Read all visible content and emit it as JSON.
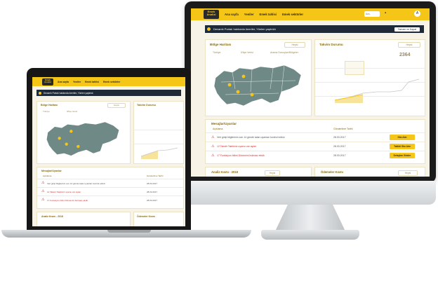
{
  "brand": {
    "logo_top": "Emek",
    "logo_bottom": "Analizi",
    "accent": "#f5c518",
    "dark": "#1f2a38"
  },
  "nav": {
    "items": [
      "Ana sayfa",
      "Yeniler",
      "Emek tahlisi",
      "Emek sektörler"
    ]
  },
  "alert": {
    "text": "Devamlı Portalı hakkında öneriler, Yönlen yaptrıldı",
    "button": "Tamam ve Kapat"
  },
  "sections": {
    "map_title": "Bölge Haritası",
    "filter_label": "Hepsi",
    "status_title": "Takvim Durumu",
    "status_value": "2364",
    "chart_legend": [
      "2019",
      "2020"
    ],
    "warnings_title": "Mesajlar/Uyarılar",
    "col_desc": "Açıklama",
    "col_date": "Gönderilme Tarihi",
    "bottom_left_title": "Analiz Kısmı - 2018",
    "bottom_right_title": "Ödemeler Kısmı"
  },
  "warnings": [
    {
      "text": "Veri girişi bilgilerinin son 14 günde talan uyarıları kontrol ediniz",
      "date": "28.03.2017",
      "action": "Göz Atın"
    },
    {
      "text": "12 Takstir Talebiniz uyarısı var ayları",
      "date": "28.03.2017",
      "action": "Taklidi Göz Atın"
    },
    {
      "text": "17 Fonksiyon bilimi Dönemini bulması eksik",
      "date": "28.03.2017",
      "action": "Detayları Göster"
    }
  ],
  "map_chips": [
    "Türkiye",
    "İl/İlçe Verisi",
    "Arama Sonuçları/Bölgeler"
  ],
  "map_points": [
    {
      "name": "point-1"
    },
    {
      "name": "point-2"
    },
    {
      "name": "point-3"
    },
    {
      "name": "point-4"
    }
  ],
  "toolbar": {
    "search": "Ara..",
    "user_initial": "A"
  }
}
